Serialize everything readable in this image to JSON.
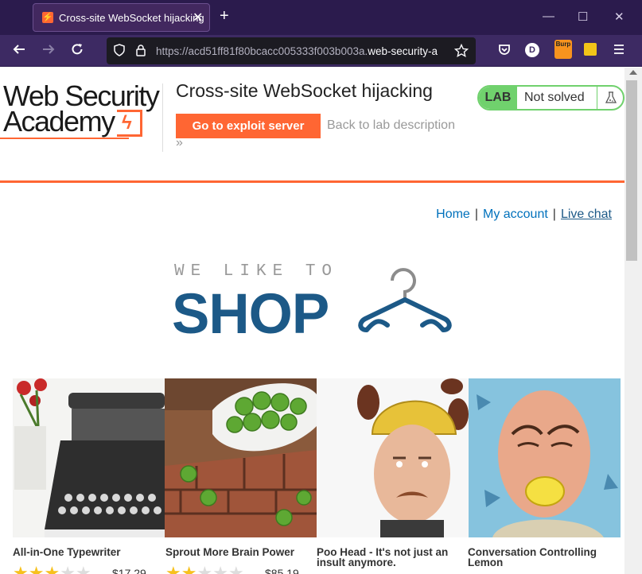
{
  "browser": {
    "tab_title": "Cross-site WebSocket hijacking",
    "tab_favicon": "⚡",
    "tab_close": "✕",
    "new_tab": "+",
    "minimize": "—",
    "maximize": "☐",
    "close": "✕",
    "url_prefix": "https://acd51ff81f80bcacc005333f003b003a.",
    "url_domain": "web-security-a",
    "ext_burp_label": "Burp",
    "profile_initial": "D"
  },
  "lab_header": {
    "logo_line1": "Web Security",
    "logo_line2": "Academy",
    "title": "Cross-site WebSocket hijacking",
    "exploit_button": "Go to exploit server",
    "back_link": "Back to lab description",
    "back_arrow": "»",
    "badge_label": "LAB",
    "badge_status": "Not solved",
    "badge_icon": "flask-icon"
  },
  "nav": {
    "home": "Home",
    "separator": "|",
    "my_account": "My account",
    "live_chat": "Live chat"
  },
  "hero": {
    "tagline": "WE LIKE TO",
    "word": "SHOP"
  },
  "products": [
    {
      "name_line1": "All-in-One Typewriter",
      "name_line2": "",
      "rating": 3,
      "price": "$17.29"
    },
    {
      "name_line1": "Sprout More Brain Power",
      "name_line2": "",
      "rating": 2,
      "price": "$85.19"
    },
    {
      "name_line1": "Poo Head - It's not just an",
      "name_line2": "insult anymore.",
      "rating": 0,
      "price": ""
    },
    {
      "name_line1": "Conversation Controlling",
      "name_line2": "Lemon",
      "rating": 0,
      "price": ""
    }
  ],
  "colors": {
    "accent": "#ff6633",
    "brand_blue": "#1c5987",
    "lab_green": "#70d16d",
    "browser_purple": "#3d2a63"
  }
}
